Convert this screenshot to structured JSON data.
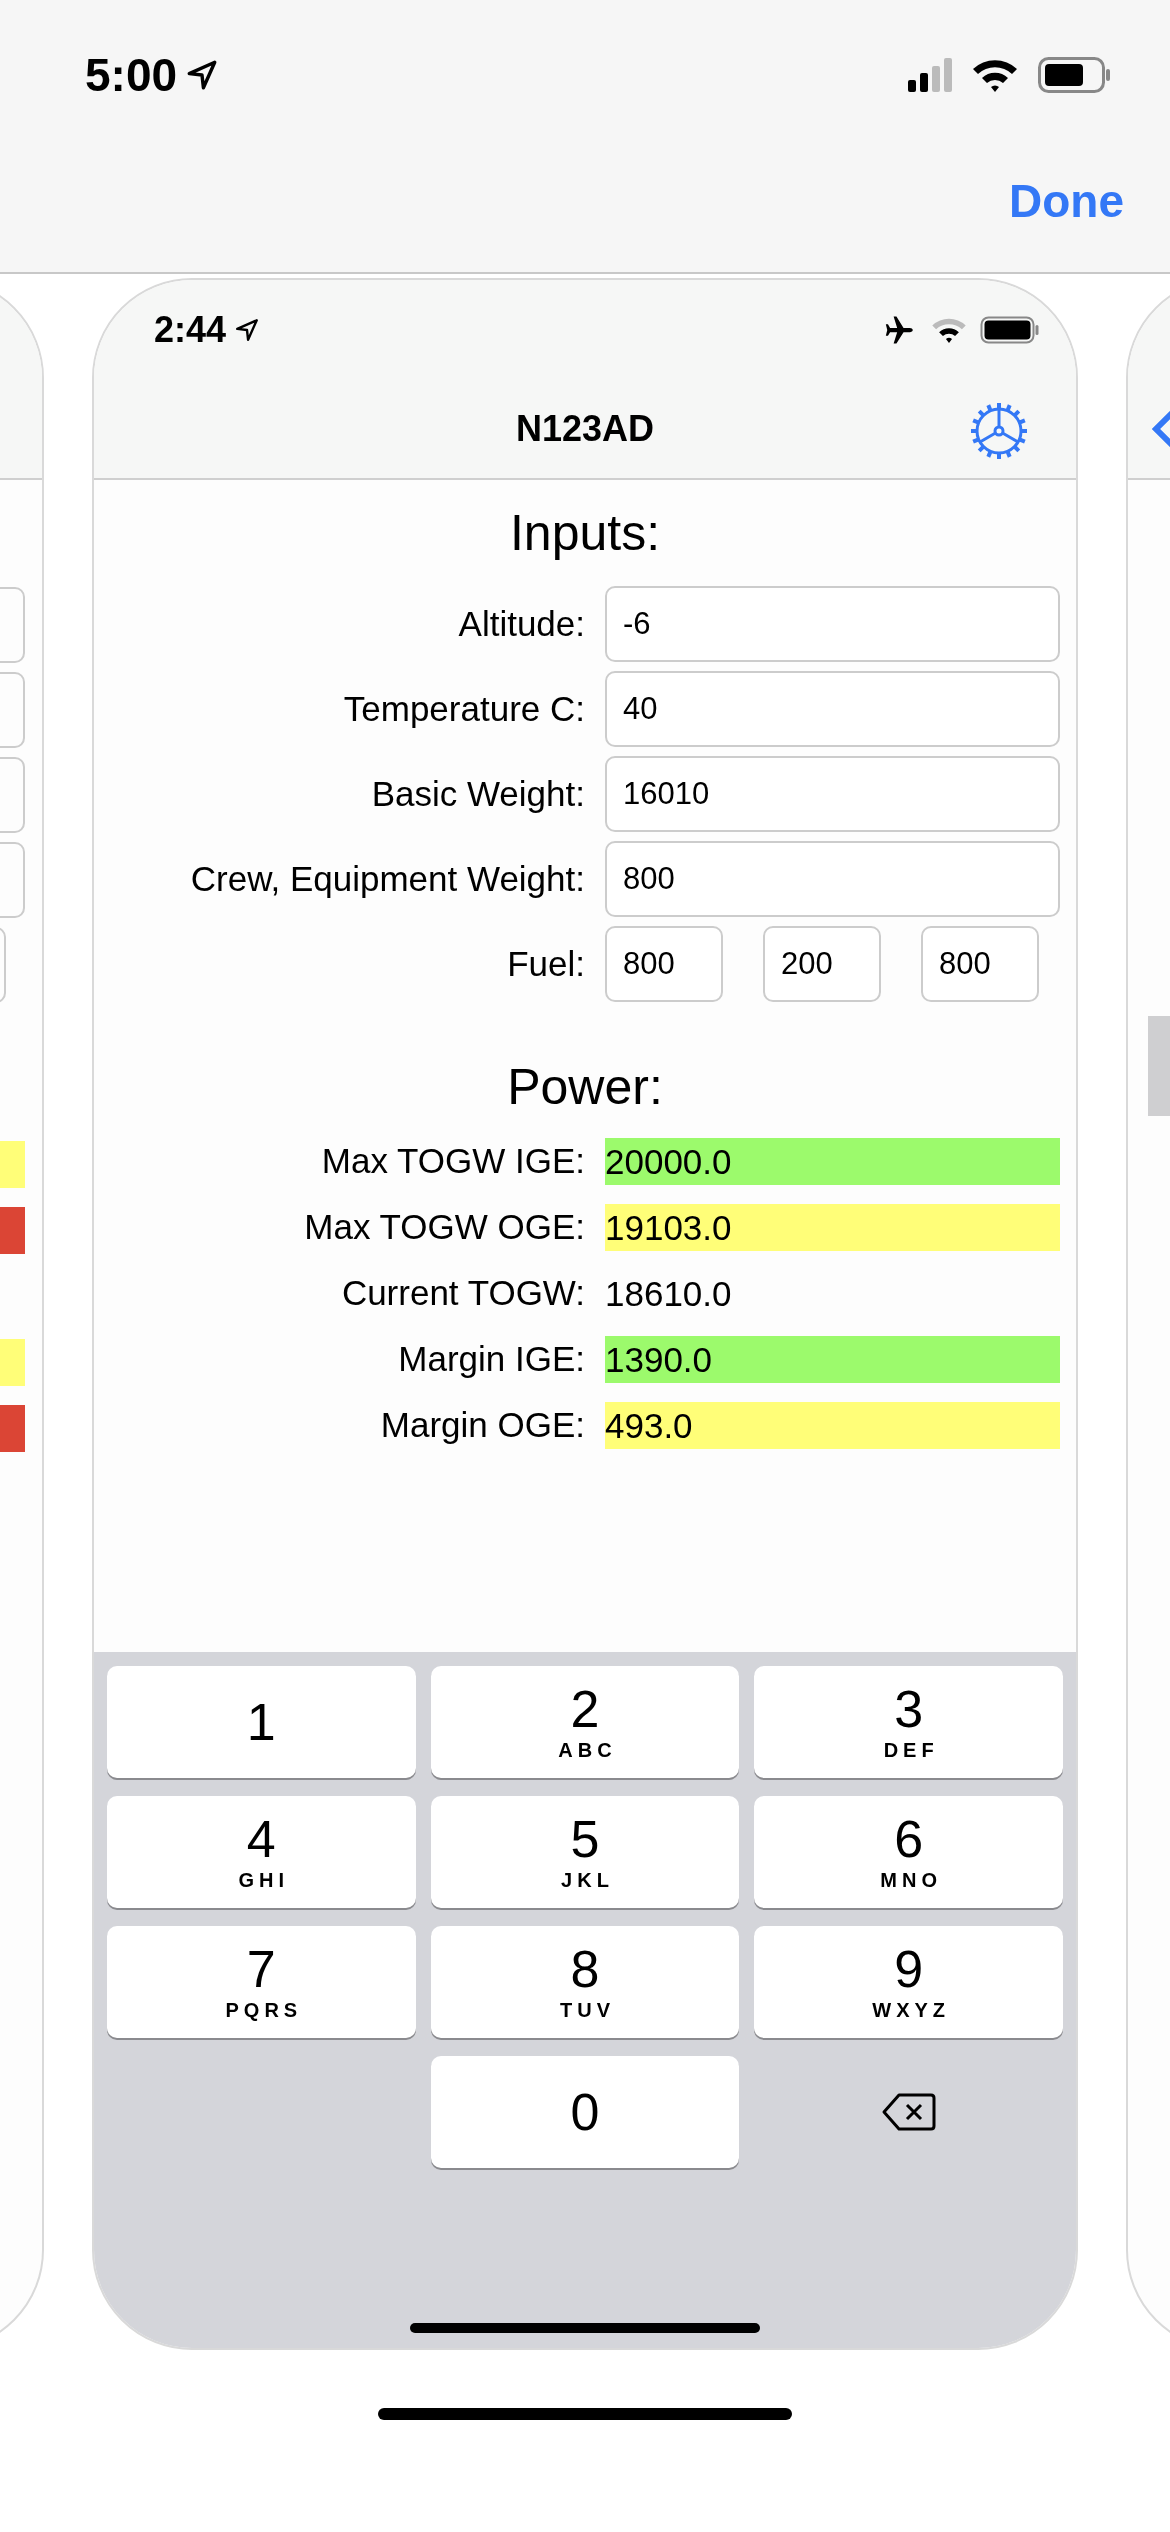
{
  "status_bar": {
    "time": "5:00"
  },
  "nav": {
    "done": "Done"
  },
  "left_card": {
    "results": [
      {
        "kind": "highlight",
        "color": "#fffe78"
      },
      {
        "kind": "highlight",
        "color": "#db4535"
      },
      {
        "kind": "plain"
      },
      {
        "kind": "highlight",
        "color": "#fffe78"
      },
      {
        "kind": "highlight",
        "color": "#db4535"
      }
    ]
  },
  "screenshot": {
    "status_bar": {
      "time": "2:44"
    },
    "title": "N123AD",
    "inputs": {
      "heading": "Inputs:",
      "rows": [
        {
          "label": "Altitude:",
          "values": [
            "-6"
          ]
        },
        {
          "label": "Temperature C:",
          "values": [
            "40"
          ]
        },
        {
          "label": "Basic Weight:",
          "values": [
            "16010"
          ]
        },
        {
          "label": "Crew, Equipment Weight:",
          "values": [
            "800"
          ]
        },
        {
          "label": "Fuel:",
          "values": [
            "800",
            "200",
            "800"
          ]
        }
      ]
    },
    "power": {
      "heading": "Power:",
      "rows": [
        {
          "label": "Max TOGW IGE:",
          "value": "20000.0",
          "color": "#9cfa6c"
        },
        {
          "label": "Max TOGW OGE:",
          "value": "19103.0",
          "color": "#fffe78"
        },
        {
          "label": "Current TOGW:",
          "value": "18610.0"
        },
        {
          "label": "Margin IGE:",
          "value": "1390.0",
          "color": "#9cfa6c"
        },
        {
          "label": "Margin OGE:",
          "value": "493.0",
          "color": "#fffe78"
        }
      ]
    },
    "keyboard": {
      "keys": [
        {
          "kind": "digit",
          "digit": "1"
        },
        {
          "kind": "digit",
          "digit": "2",
          "letters": "ABC"
        },
        {
          "kind": "digit",
          "digit": "3",
          "letters": "DEF"
        },
        {
          "kind": "digit",
          "digit": "4",
          "letters": "GHI"
        },
        {
          "kind": "digit",
          "digit": "5",
          "letters": "JKL"
        },
        {
          "kind": "digit",
          "digit": "6",
          "letters": "MNO"
        },
        {
          "kind": "digit",
          "digit": "7",
          "letters": "PQRS"
        },
        {
          "kind": "digit",
          "digit": "8",
          "letters": "TUV"
        },
        {
          "kind": "digit",
          "digit": "9",
          "letters": "WXYZ"
        },
        {
          "kind": "blank"
        },
        {
          "kind": "digit",
          "digit": "0"
        },
        {
          "kind": "delete"
        }
      ]
    }
  }
}
